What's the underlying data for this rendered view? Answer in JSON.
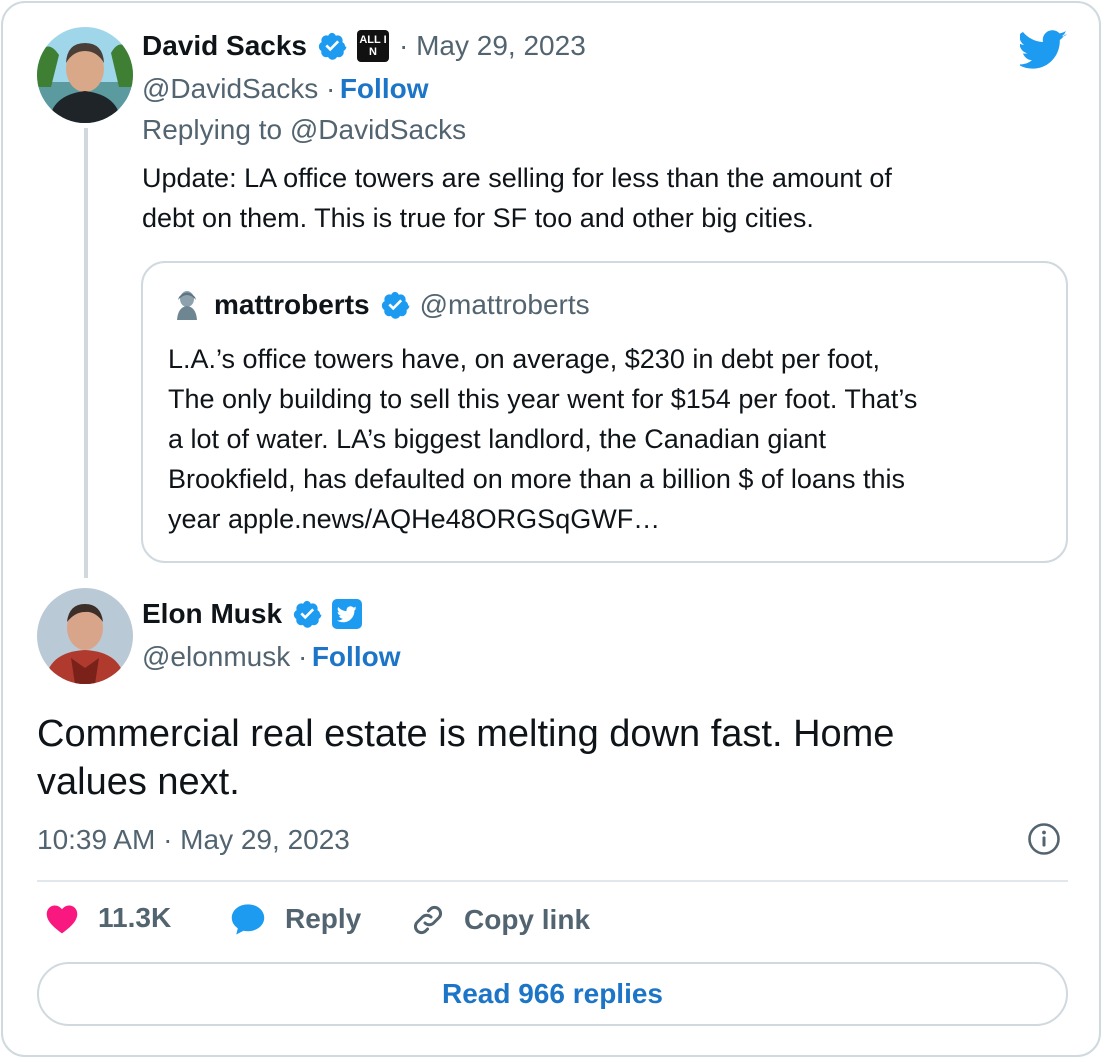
{
  "parent_tweet": {
    "author_name": "David Sacks",
    "badge_text": "ALL IN",
    "date": "· May 29, 2023",
    "handle": "@DavidSacks ·",
    "follow_label": "Follow",
    "replying_to": "Replying to @DavidSacks",
    "text_line1": "Update: LA office towers are selling for less than the amount of",
    "text_line2": "debt on them. This is true for SF too and other big cities."
  },
  "quoted_tweet": {
    "author_name": "mattroberts",
    "handle": "@mattroberts",
    "lines": [
      "L.A.’s office towers have, on average, $230 in debt per foot,",
      "The only building to sell this year went for $154 per foot. That’s",
      "a lot of water. LA’s biggest landlord, the Canadian giant",
      "Brookfield, has defaulted on more than a billion $ of loans this",
      "year apple.news/AQHe48ORGSqGWF…"
    ]
  },
  "main_tweet": {
    "author_name": "Elon Musk",
    "handle": "@elonmusk ·",
    "follow_label": "Follow",
    "text_line1": "Commercial real estate is melting down fast. Home",
    "text_line2": "values next.",
    "timestamp": "10:39 AM · May 29, 2023"
  },
  "actions": {
    "likes_count": "11.3K",
    "reply_label": "Reply",
    "copy_link_label": "Copy link"
  },
  "read_replies_label": "Read 966 replies",
  "colors": {
    "accent": "#1d75c8",
    "twitter_blue": "#1d9bf0",
    "heart": "#f91880",
    "verified": "#1d9bf0"
  },
  "icons": [
    "twitter-bird-icon",
    "verified-badge-icon",
    "info-icon",
    "heart-icon",
    "reply-bubble-icon",
    "link-icon"
  ]
}
